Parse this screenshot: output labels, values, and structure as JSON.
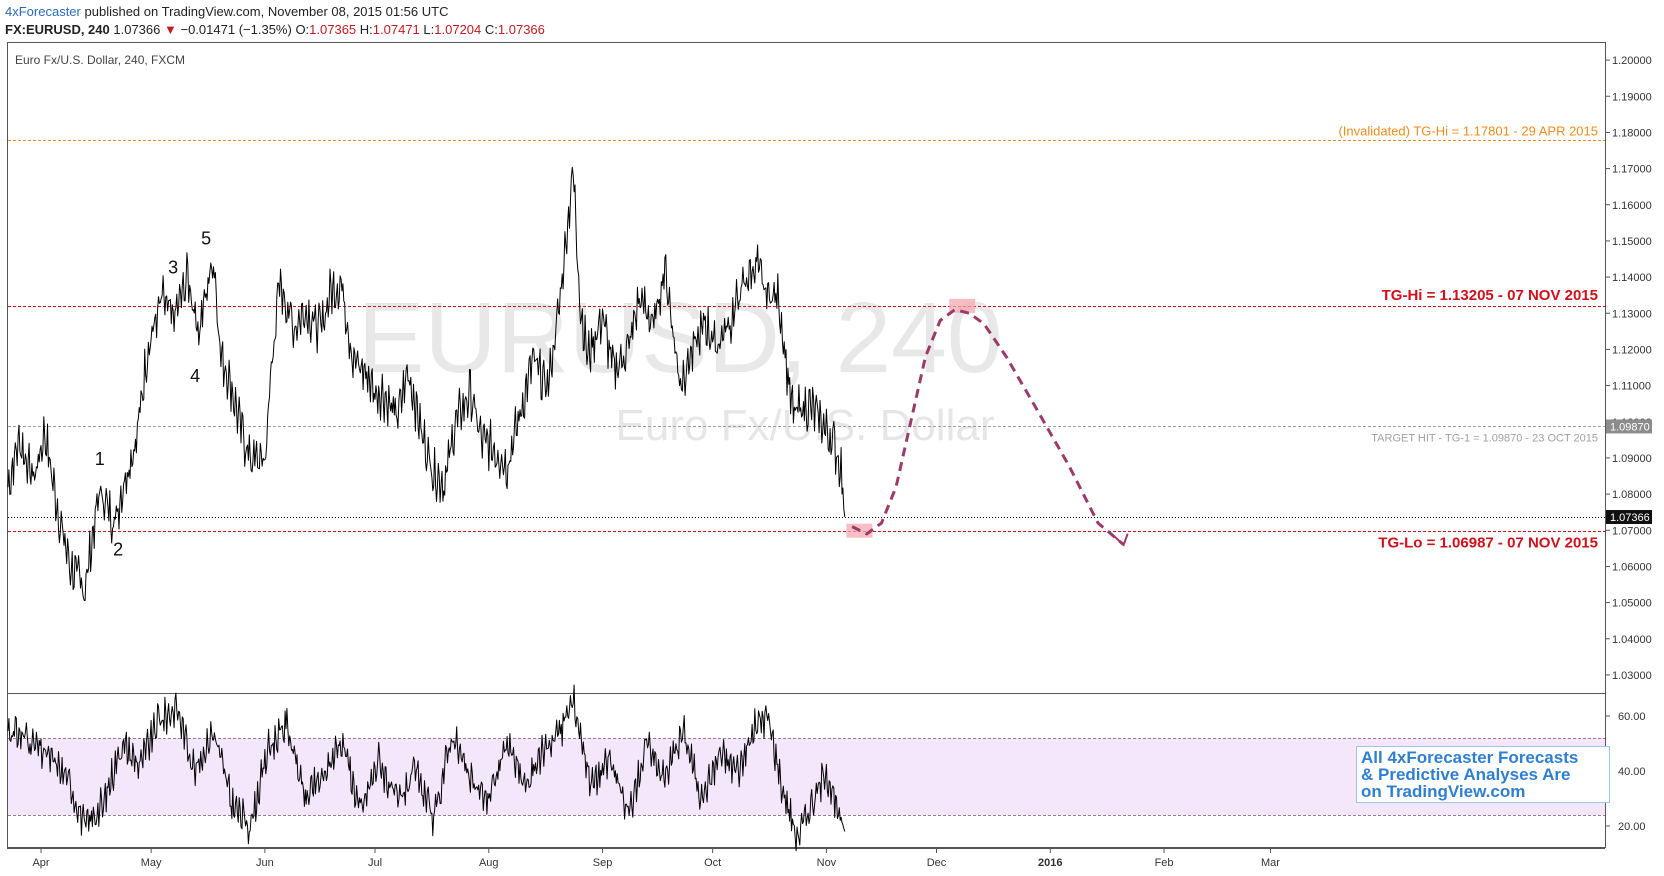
{
  "header": {
    "author": "4xForecaster",
    "published_text": "published on TradingView.com, November 08, 2015 01:56 UTC",
    "symbol": "FX:EURUSD, 240",
    "last": "1.07366",
    "arrow": "▼",
    "change": "−0.01471 (−1.35%)",
    "o_label": "O:",
    "o_value": "1.07365",
    "h_label": "H:",
    "h_value": "1.07471",
    "l_label": "L:",
    "l_value": "1.07204",
    "c_label": "C:",
    "c_value": "1.07366"
  },
  "chart_title": "Euro Fx/U.S. Dollar, 240, FXCM",
  "watermark": {
    "symbol": "EURUSD, 240",
    "description": "Euro Fx/U.S. Dollar"
  },
  "colors": {
    "price_line": "#000000",
    "target_red": "#d0101a",
    "invalidated_orange": "#f08c1a",
    "target_hit_gray": "#a0a0a0",
    "forecast_path": "#9b3a6b",
    "rsi_band_fill": "#f4e6fb",
    "promo_blue": "#2f7fd0"
  },
  "annotations": {
    "invalidated": "(Invalidated) TG-Hi = 1.17801 - 29 APR 2015",
    "tg_hi": "TG-Hi = 1.13205 - 07 NOV 2015",
    "target_hit": "TARGET HIT - TG-1 = 1.09870 - 23 OCT 2015",
    "tg_lo": "TG-Lo = 1.06987 - 07 NOV 2015",
    "price_badge_target": "1.09870",
    "price_badge_last": "1.07366",
    "promo_line1": "All 4xForecaster Forecasts",
    "promo_line2": "& Predictive Analyses Are",
    "promo_line3": "on TradingView.com"
  },
  "chart_data": [
    {
      "type": "line",
      "title": "Euro Fx/U.S. Dollar, 240, FXCM",
      "x_tick_labels": [
        "Apr",
        "May",
        "Jun",
        "Jul",
        "Aug",
        "Sep",
        "Oct",
        "Nov",
        "Dec",
        "2016",
        "Feb",
        "Mar"
      ],
      "y_tick_labels": [
        "1.03000",
        "1.04000",
        "1.05000",
        "1.06000",
        "1.07000",
        "1.08000",
        "1.09000",
        "1.10000",
        "1.11000",
        "1.12000",
        "1.13000",
        "1.14000",
        "1.15000",
        "1.16000",
        "1.17000",
        "1.18000",
        "1.19000",
        "1.20000"
      ],
      "ylim": [
        1.025,
        1.205
      ],
      "series": [
        {
          "x": [
            "2015-03-23",
            "2015-03-26",
            "2015-03-30",
            "2015-04-02",
            "2015-04-06",
            "2015-04-09",
            "2015-04-13",
            "2015-04-15",
            "2015-04-17",
            "2015-04-21",
            "2015-04-24",
            "2015-04-27",
            "2015-04-30",
            "2015-05-04",
            "2015-05-07",
            "2015-05-11",
            "2015-05-14",
            "2015-05-18",
            "2015-05-20",
            "2015-05-22",
            "2015-05-26",
            "2015-05-28",
            "2015-06-01",
            "2015-06-03",
            "2015-06-05",
            "2015-06-09",
            "2015-06-12",
            "2015-06-16",
            "2015-06-19",
            "2015-06-22",
            "2015-06-25",
            "2015-06-29",
            "2015-07-01",
            "2015-07-03",
            "2015-07-07",
            "2015-07-10",
            "2015-07-14",
            "2015-07-17",
            "2015-07-20",
            "2015-07-23",
            "2015-07-27",
            "2015-07-30",
            "2015-08-03",
            "2015-08-06",
            "2015-08-10",
            "2015-08-13",
            "2015-08-17",
            "2015-08-20",
            "2015-08-24",
            "2015-08-26",
            "2015-08-28",
            "2015-09-01",
            "2015-09-04",
            "2015-09-08",
            "2015-09-11",
            "2015-09-15",
            "2015-09-18",
            "2015-09-22",
            "2015-09-25",
            "2015-09-29",
            "2015-10-02",
            "2015-10-06",
            "2015-10-09",
            "2015-10-13",
            "2015-10-15",
            "2015-10-19",
            "2015-10-22",
            "2015-10-23",
            "2015-10-27",
            "2015-10-30",
            "2015-11-03",
            "2015-11-05",
            "2015-11-06"
          ],
          "values": [
            1.082,
            1.095,
            1.084,
            1.097,
            1.073,
            1.06,
            1.054,
            1.068,
            1.081,
            1.072,
            1.085,
            1.095,
            1.12,
            1.134,
            1.128,
            1.14,
            1.125,
            1.146,
            1.118,
            1.113,
            1.096,
            1.09,
            1.089,
            1.118,
            1.138,
            1.126,
            1.131,
            1.125,
            1.136,
            1.138,
            1.117,
            1.113,
            1.108,
            1.108,
            1.101,
            1.114,
            1.096,
            1.086,
            1.083,
            1.1,
            1.108,
            1.095,
            1.092,
            1.088,
            1.104,
            1.117,
            1.109,
            1.13,
            1.17,
            1.131,
            1.118,
            1.129,
            1.114,
            1.12,
            1.134,
            1.127,
            1.143,
            1.111,
            1.118,
            1.127,
            1.121,
            1.128,
            1.137,
            1.144,
            1.136,
            1.134,
            1.108,
            1.102,
            1.105,
            1.101,
            1.094,
            1.087,
            1.0737
          ]
        }
      ],
      "levels": [
        {
          "label": "(Invalidated) TG-Hi = 1.17801 - 29 APR 2015",
          "value": 1.17801
        },
        {
          "label": "TG-Hi = 1.13205 - 07 NOV 2015",
          "value": 1.13205
        },
        {
          "label": "TARGET HIT - TG-1 = 1.09870 - 23 OCT 2015",
          "value": 1.0987
        },
        {
          "label": "Last",
          "value": 1.07366
        },
        {
          "label": "TG-Lo = 1.06987 - 07 NOV 2015",
          "value": 1.06987
        }
      ],
      "wave_labels": [
        {
          "label": "1",
          "date": "2015-04-17",
          "value": 1.088
        },
        {
          "label": "2",
          "date": "2015-04-22",
          "value": 1.063
        },
        {
          "label": "3",
          "date": "2015-05-07",
          "value": 1.141
        },
        {
          "label": "4",
          "date": "2015-05-13",
          "value": 1.111
        },
        {
          "label": "5",
          "date": "2015-05-16",
          "value": 1.149
        }
      ],
      "forecast_path": {
        "x": [
          "2015-11-08",
          "2015-11-12",
          "2015-11-16",
          "2015-11-20",
          "2015-11-24",
          "2015-11-28",
          "2015-12-02",
          "2015-12-06",
          "2015-12-10",
          "2015-12-14",
          "2015-12-20",
          "2015-12-28",
          "2016-01-06",
          "2016-01-14",
          "2016-01-21"
        ],
        "values": [
          1.071,
          1.069,
          1.072,
          1.082,
          1.1,
          1.118,
          1.128,
          1.131,
          1.13,
          1.127,
          1.118,
          1.104,
          1.088,
          1.072,
          1.066
        ]
      },
      "grid": false
    },
    {
      "type": "line",
      "title": "",
      "y_tick_labels": [
        "20.00",
        "40.00",
        "60.00"
      ],
      "ylim": [
        12,
        68
      ],
      "band": [
        24,
        52
      ],
      "series": [
        {
          "x": [
            "2015-03-23",
            "2015-03-28",
            "2015-04-03",
            "2015-04-08",
            "2015-04-13",
            "2015-04-18",
            "2015-04-23",
            "2015-04-28",
            "2015-05-03",
            "2015-05-08",
            "2015-05-13",
            "2015-05-18",
            "2015-05-23",
            "2015-05-28",
            "2015-06-02",
            "2015-06-07",
            "2015-06-12",
            "2015-06-17",
            "2015-06-22",
            "2015-06-27",
            "2015-07-02",
            "2015-07-07",
            "2015-07-12",
            "2015-07-17",
            "2015-07-22",
            "2015-07-27",
            "2015-08-01",
            "2015-08-06",
            "2015-08-11",
            "2015-08-16",
            "2015-08-21",
            "2015-08-24",
            "2015-08-29",
            "2015-09-03",
            "2015-09-08",
            "2015-09-13",
            "2015-09-18",
            "2015-09-23",
            "2015-09-28",
            "2015-10-03",
            "2015-10-08",
            "2015-10-13",
            "2015-10-16",
            "2015-10-20",
            "2015-10-24",
            "2015-10-28",
            "2015-11-01",
            "2015-11-04",
            "2015-11-06"
          ],
          "values": [
            55,
            52,
            45,
            38,
            20,
            28,
            50,
            42,
            58,
            63,
            40,
            55,
            28,
            20,
            48,
            57,
            30,
            38,
            52,
            25,
            44,
            28,
            40,
            22,
            54,
            36,
            30,
            50,
            34,
            48,
            56,
            66,
            35,
            44,
            24,
            50,
            38,
            55,
            30,
            46,
            40,
            57,
            60,
            34,
            16,
            28,
            40,
            24,
            18
          ]
        }
      ],
      "grid": false
    }
  ]
}
